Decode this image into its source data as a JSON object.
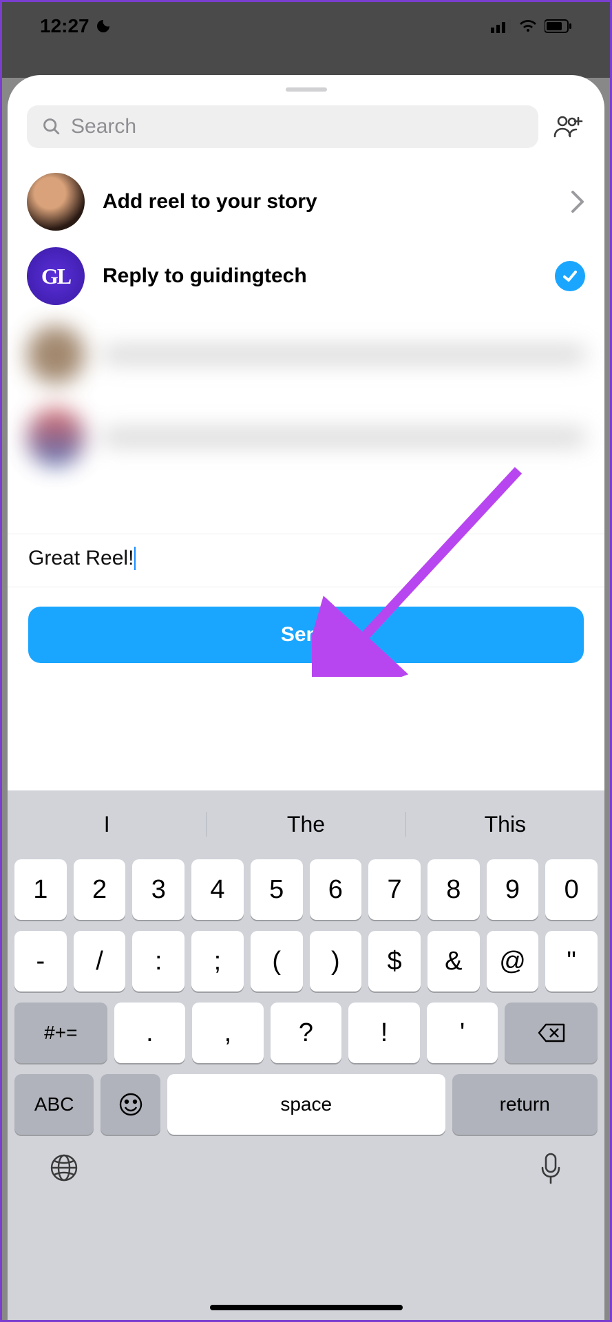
{
  "status": {
    "time": "12:27"
  },
  "search": {
    "placeholder": "Search"
  },
  "items": {
    "add_story": "Add reel to your story",
    "reply_to": "Reply to guidingtech",
    "gt_logo": "GL"
  },
  "message": {
    "text": "Great Reel!"
  },
  "send": {
    "label": "Send"
  },
  "suggestions": [
    "I",
    "The",
    "This"
  ],
  "kb": {
    "row1": [
      "1",
      "2",
      "3",
      "4",
      "5",
      "6",
      "7",
      "8",
      "9",
      "0"
    ],
    "row2": [
      "-",
      "/",
      ":",
      ";",
      "(",
      ")",
      "$",
      "&",
      "@",
      "\""
    ],
    "row3_shift": "#+=",
    "row3": [
      ".",
      ",",
      "?",
      "!",
      "'"
    ],
    "abc": "ABC",
    "space": "space",
    "return": "return"
  }
}
